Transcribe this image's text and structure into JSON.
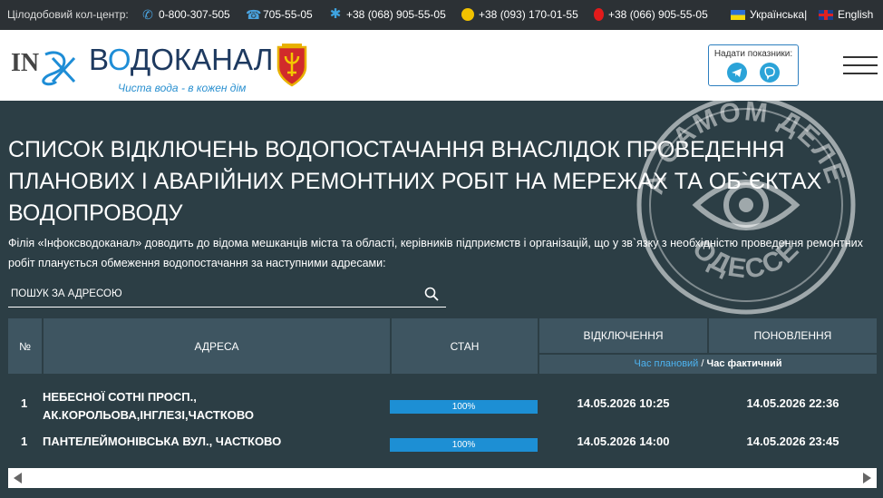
{
  "topbar": {
    "callcenter_label": "Цілодобовий кол-центр:",
    "phones": [
      {
        "icon": "phone-icon",
        "number": "0-800-307-505"
      },
      {
        "icon": "landline-icon",
        "number": "705-55-05"
      },
      {
        "icon": "kyivstar-icon",
        "number": "+38 (068) 905-55-05"
      },
      {
        "icon": "lifecell-icon",
        "number": "+38 (093) 170-01-55"
      },
      {
        "icon": "vodafone-icon",
        "number": "+38 (066) 905-55-05"
      }
    ],
    "lang_ua": "Українська|",
    "lang_en": "English"
  },
  "header": {
    "logo_main_prefix": "В",
    "logo_main_o": "О",
    "logo_main_rest": "ДОКАНАЛ",
    "logo_slogan": "Чиста вода - в кожен дім",
    "readings_label": "Надати показники:",
    "readings_telegram": "telegram-icon",
    "readings_viber": "viber-icon"
  },
  "main": {
    "title": "СПИСОК ВІДКЛЮЧЕНЬ ВОДОПОСТАЧАННЯ ВНАСЛІДОК ПРОВЕДЕННЯ ПЛАНОВИХ І АВАРІЙНИХ РЕМОНТНИХ РОБІТ НА МЕРЕЖАХ ТА ОБ`ЄКТАХ ВОДОПРОВОДУ",
    "intro": "Філія «Інфоксводоканал» доводить до відома мешканців міста та області, керівників підприємств і організацій, що у зв`язку з необхідністю проведення ремонтних робіт планується обмеження водопостачання за наступними адресами:",
    "search_placeholder": "ПОШУК ЗА АДРЕСОЮ"
  },
  "table": {
    "headers": {
      "num": "№",
      "address": "АДРЕСА",
      "state": "СТАН",
      "off": "ВІДКЛЮЧЕННЯ",
      "on": "ПОНОВЛЕННЯ",
      "planned": "Час плановий",
      "sep": " / ",
      "actual": "Час фактичний"
    },
    "rows": [
      {
        "num": "1",
        "address": "НЕБЕСНОЇ СОТНІ ПРОСП., АК.КОРОЛЬОВА,ІНГЛЕЗІ,ЧАСТКОВО",
        "progress": 100,
        "progress_label": "100%",
        "off": "14.05.2026 10:25",
        "on": "14.05.2026 22:36"
      },
      {
        "num": "1",
        "address": "ПАНТЕЛЕЙМОНІВСЬКА ВУЛ., ЧАСТКОВО",
        "progress": 100,
        "progress_label": "100%",
        "off": "14.05.2026 14:00",
        "on": "14.05.2026 23:45"
      }
    ]
  },
  "watermark": {
    "top_text": "НА САМОМ ДЕЛЕ В",
    "bottom_text": "ОДЕССЕ"
  },
  "colors": {
    "accent": "#1d8fd4",
    "page_bg": "#2c3e45",
    "table_head": "#3e5561",
    "topbar_bg": "#2c3135"
  }
}
